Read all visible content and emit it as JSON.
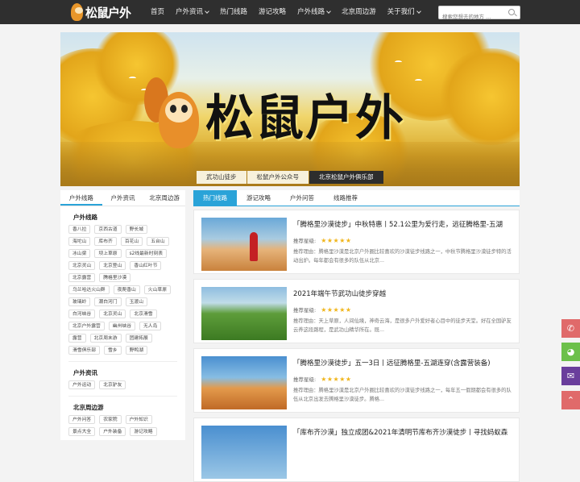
{
  "header": {
    "logo_text": "松鼠户外",
    "nav": [
      {
        "label": "首页",
        "dropdown": false
      },
      {
        "label": "户外资讯",
        "dropdown": true
      },
      {
        "label": "热门线路",
        "dropdown": false
      },
      {
        "label": "游记攻略",
        "dropdown": false
      },
      {
        "label": "户外线路",
        "dropdown": true
      },
      {
        "label": "北京周边游",
        "dropdown": false
      },
      {
        "label": "关于我们",
        "dropdown": true
      }
    ],
    "search_placeholder": "搜索您想去的地方 ..."
  },
  "banner": {
    "title": "松鼠户外",
    "tabs": [
      {
        "label": "武功山徒步",
        "active": false
      },
      {
        "label": "松鼠户外公众号",
        "active": false
      },
      {
        "label": "北京松鼠户外俱乐部",
        "active": true
      }
    ]
  },
  "sidebar": {
    "tabs": [
      {
        "label": "户外线路",
        "active": true
      },
      {
        "label": "户外资讯",
        "active": false
      },
      {
        "label": "北京周边游",
        "active": false
      }
    ],
    "groups": [
      {
        "title": "户外线路",
        "tags": [
          "香八拉",
          "京西古道",
          "野长城",
          "海坨山",
          "库布齐",
          "百花山",
          "五台山",
          "冰山梁",
          "坝上草原",
          "s2线最新时刻表",
          "北京灵山",
          "北京登山",
          "香山红叶节",
          "北京露营",
          "腾格里沙漠",
          "乌兰哈达火山群",
          "夜爬香山",
          "火山草原",
          "玻璃岭",
          "潮白河门",
          "玉渡山",
          "白河峡谷",
          "北京灵山",
          "北京滑雪",
          "北京户外露营",
          "幽州峡谷",
          "无人岛",
          "露营",
          "北京周末游",
          "团建拓展",
          "滑雪俱乐部",
          "雪乡",
          "野鸭湖"
        ]
      },
      {
        "title": "户外资讯",
        "tags": [
          "户外运动",
          "北京驴友"
        ]
      },
      {
        "title": "北京周边游",
        "tags": [
          "户外问答",
          "农家院",
          "户外知识",
          "景点大全",
          "户外装备",
          "游记攻略"
        ]
      }
    ]
  },
  "main": {
    "tabs": [
      {
        "label": "热门线路",
        "active": true
      },
      {
        "label": "游记攻略",
        "active": false
      },
      {
        "label": "户外问答",
        "active": false
      },
      {
        "label": "线路推荐",
        "active": false
      }
    ],
    "rating_label": "推荐星级:",
    "cards": [
      {
        "title": "「腾格里沙漠徒步」中秋特惠丨52.1公里为爱行走，远征腾格里-五湖",
        "stars": "★★★★★",
        "desc": "推荐理由：腾格里沙漠是北京户外圈比较喜欢的沙漠徒步线路之一，中秋节腾格里沙漠徒步特的活动出炉。每年都会有很多的队伍从北京..."
      },
      {
        "title": "2021年端午节武功山徒步穿越",
        "stars": "★★★★★",
        "desc": "推荐理由：天上草原，人间仙境，神奇云海，是很多户外爱好者心目中的徒步天堂。好在全国驴友云养这段路程，是武功山精华所在。既..."
      },
      {
        "title": "「腾格里沙漠徒步」五一3日丨远征腾格里-五湖连穿(含露营装备)",
        "stars": "★★★★★",
        "desc": "推荐理由：腾格里沙漠是北京户外圈比较喜欢的沙漠徒步线路之一，每年五一假期都会有很多的队伍从北京出发去腾格里沙漠徒步。腾格..."
      },
      {
        "title": "「库布齐沙漠」独立成团&2021年清明节库布齐沙漠徒步丨寻找蚂蚁森",
        "stars": "",
        "desc": ""
      }
    ]
  },
  "float_buttons": [
    {
      "name": "phone",
      "color": "#e05656"
    },
    {
      "name": "qq",
      "color": "#6cc04a"
    },
    {
      "name": "wechat",
      "color": "#6a3e9c"
    },
    {
      "name": "back-to-top",
      "color": "#e05656"
    }
  ],
  "colors": {
    "accent": "#2aa3d8",
    "header_bg": "#2f2f2f",
    "star": "#f0b51a"
  }
}
